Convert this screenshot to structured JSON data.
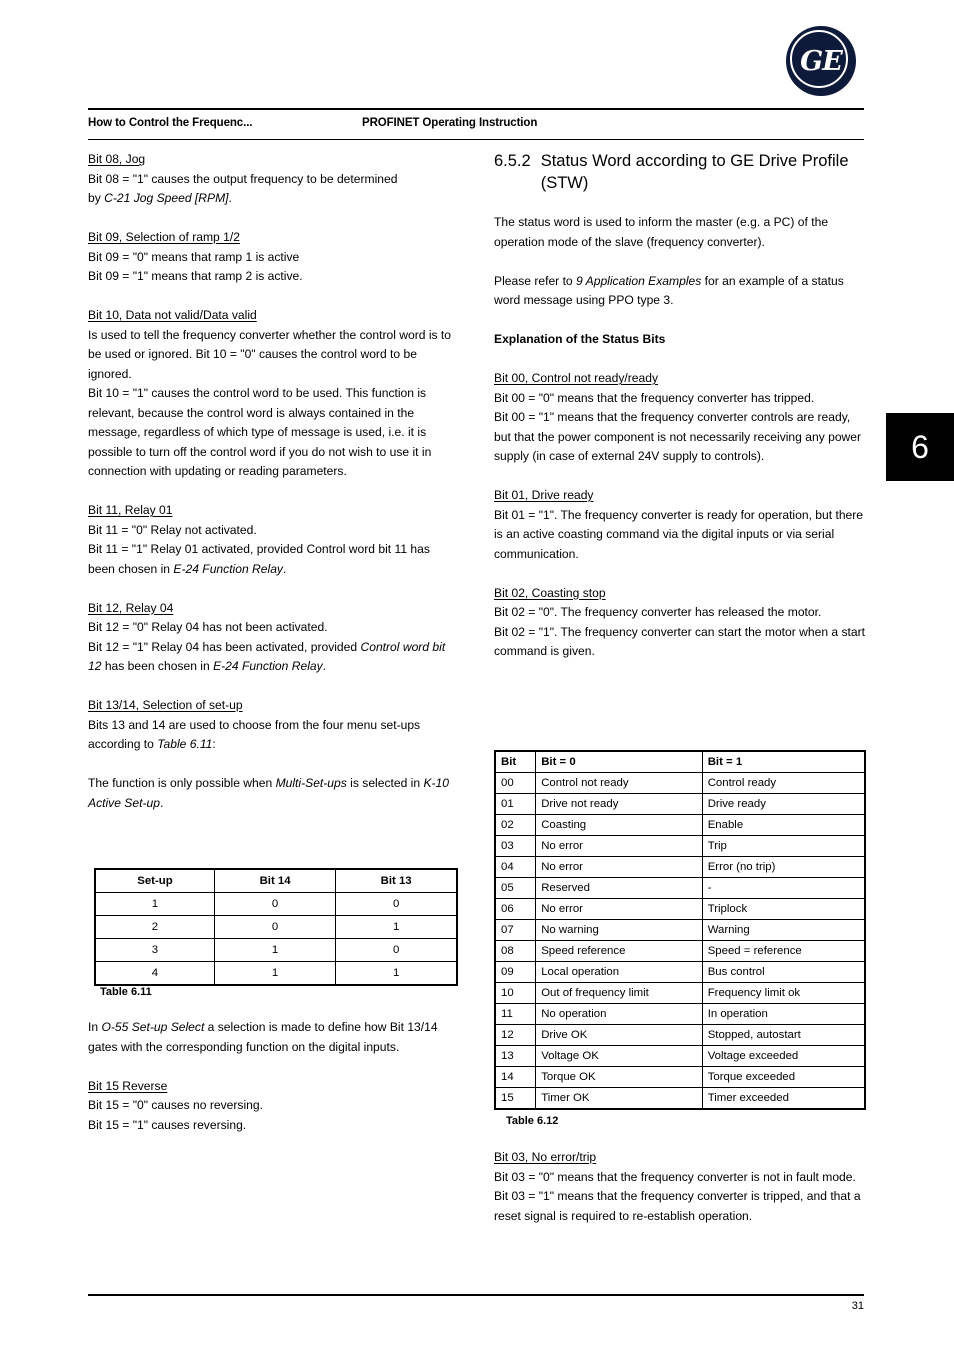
{
  "logo": {
    "monogram": "GE"
  },
  "header": {
    "left": "How to Control the Frequenc...",
    "right": "PROFINET Operating Instruction"
  },
  "chapter_tab": "6",
  "footer": {
    "page_number": "31"
  },
  "left_column": {
    "bit08": {
      "heading": "Bit 08, Jog",
      "line1": "Bit 08 = \"1\" causes the output frequency to be determined",
      "line2_pre": "by ",
      "line2_em": "C-21 Jog Speed [RPM]",
      "line2_post": "."
    },
    "bit09": {
      "heading": "Bit 09, Selection of ramp 1/2",
      "line1": "Bit 09 = \"0\" means that ramp 1 is active",
      "line2": "Bit 09 = \"1\" means that ramp 2 is active."
    },
    "bit10": {
      "heading": "Bit 10, Data not valid/Data valid",
      "body": "Is used to tell the frequency converter whether the control word is to be used or ignored. Bit 10 = \"0\" causes the control word to be ignored.",
      "body2": "Bit 10 = \"1\" causes the control word to be used. This function is relevant, because the control word is always contained in the message, regardless of which type of message is used, i.e. it is possible to turn off the control word if you do not wish to use it in connection with updating or reading parameters."
    },
    "bit11": {
      "heading": "Bit 11, Relay 01",
      "line1": "Bit 11 = \"0\" Relay not activated.",
      "line2_pre": "Bit 11 = \"1\" Relay 01 activated, provided Control word bit 11 has been chosen in ",
      "line2_em": "E-24 Function Relay",
      "line2_post": "."
    },
    "bit12": {
      "heading": "Bit 12, Relay 04",
      "line1": "Bit 12 = \"0\" Relay 04 has not been activated.",
      "line2_pre": "Bit 12 = \"1\" Relay 04 has been activated, provided ",
      "line2_em1": "Control word bit 12",
      "line2_mid": " has been chosen in ",
      "line2_em2": "E-24 Function Relay",
      "line2_post": "."
    },
    "bit1314": {
      "heading": "Bit 13/14, Selection of set-up",
      "line1_pre": "Bits 13 and 14 are used to choose from the four menu set-ups according to ",
      "line1_em": "Table 6.11",
      "line1_post": ":",
      "para2_pre": "The function is only possible when ",
      "para2_em1": "Multi-Set-ups",
      "para2_mid": " is selected in ",
      "para2_em2": "K-10 Active Set-up",
      "para2_post": "."
    },
    "o55": {
      "pre": "In ",
      "em": "O-55 Set-up Select",
      "post": " a selection is made to define how Bit 13/14 gates with the corresponding function on the digital inputs."
    },
    "bit15": {
      "heading": "Bit 15 Reverse",
      "line1": "Bit 15 = \"0\" causes no reversing.",
      "line2": "Bit 15 = \"1\" causes reversing."
    }
  },
  "right_column": {
    "section": {
      "number": "6.5.2",
      "title": "Status Word according to GE Drive Profile (STW)"
    },
    "intro": "The status word is used to inform the master (e.g. a PC) of the operation mode of the slave (frequency converter).",
    "refer": {
      "pre": "Please refer to ",
      "em": "9 Application Examples",
      "post": " for an example of a status word message using PPO type 3."
    },
    "explanation_heading": "Explanation of the Status Bits",
    "bit00": {
      "heading": "Bit 00, Control not ready/ready",
      "line1": "Bit 00 = \"0\" means that the frequency converter has tripped.",
      "line2": "Bit 00 = \"1\" means that the frequency converter controls are ready, but that the power component is not necessarily receiving any power supply (in case of external 24V supply to controls)."
    },
    "bit01": {
      "heading": "Bit 01, Drive ready",
      "line1": "Bit 01 = \"1\". The frequency converter is ready for operation, but there is an active coasting command via the digital inputs or via serial communication."
    },
    "bit02": {
      "heading": "Bit 02, Coasting stop",
      "line1": "Bit 02 = \"0\". The frequency converter has released the motor.",
      "line2": "Bit 02 = \"1\". The frequency converter can start the motor when a start command is given."
    },
    "bit03": {
      "heading": "Bit 03, No error/trip",
      "line1": "Bit 03 = \"0\" means that the frequency converter is not in fault mode.",
      "line2": "Bit 03 = \"1\" means that the frequency converter is tripped, and that a reset signal is required to re-establish operation."
    }
  },
  "table_setup": {
    "caption": "Table 6.11",
    "columns": [
      "Set-up",
      "Bit 14",
      "Bit 13"
    ],
    "rows": [
      [
        "1",
        "0",
        "0"
      ],
      [
        "2",
        "0",
        "1"
      ],
      [
        "3",
        "1",
        "0"
      ],
      [
        "4",
        "1",
        "1"
      ]
    ]
  },
  "table_stw": {
    "caption": "Table 6.12",
    "columns": [
      "Bit",
      "Bit = 0",
      "Bit = 1"
    ],
    "rows": [
      [
        "00",
        "Control not ready",
        "Control ready"
      ],
      [
        "01",
        "Drive not ready",
        "Drive ready"
      ],
      [
        "02",
        "Coasting",
        "Enable"
      ],
      [
        "03",
        "No error",
        "Trip"
      ],
      [
        "04",
        "No error",
        "Error (no trip)"
      ],
      [
        "05",
        "Reserved",
        "-"
      ],
      [
        "06",
        "No error",
        "Triplock"
      ],
      [
        "07",
        "No warning",
        "Warning"
      ],
      [
        "08",
        "Speed reference",
        "Speed = reference"
      ],
      [
        "09",
        "Local operation",
        "Bus control"
      ],
      [
        "10",
        "Out of frequency limit",
        "Frequency limit ok"
      ],
      [
        "11",
        "No operation",
        "In operation"
      ],
      [
        "12",
        "Drive OK",
        "Stopped, autostart"
      ],
      [
        "13",
        "Voltage OK",
        "Voltage exceeded"
      ],
      [
        "14",
        "Torque OK",
        "Torque exceeded"
      ],
      [
        "15",
        "Timer OK",
        "Timer exceeded"
      ]
    ]
  }
}
